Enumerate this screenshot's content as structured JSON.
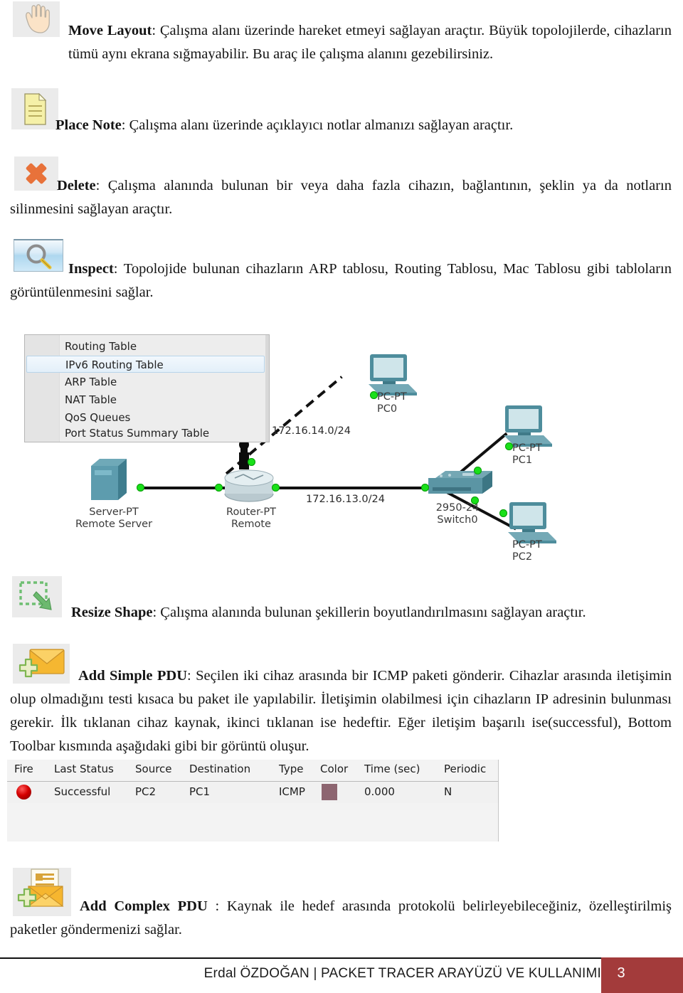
{
  "document": {
    "language": "Turkish",
    "sections": [
      {
        "id": "move-layout",
        "term": "Move Layout",
        "body": ": Çalışma alanı üzerinde hareket etmeyi sağlayan araçtır. Büyük topolojilerde, cihazların tümü aynı ekrana sığmayabilir. Bu araç ile çalışma alanını gezebilirsiniz.",
        "icon": "hand-icon"
      },
      {
        "id": "place-note",
        "term": "Place Note",
        "body": ": Çalışma alanı üzerinde açıklayıcı notlar almanızı sağlayan araçtır.",
        "icon": "note-icon"
      },
      {
        "id": "delete",
        "term": "Delete",
        "body": ": Çalışma alanında bulunan bir veya daha fazla cihazın, bağlantının, şeklin ya da notların silinmesini sağlayan araçtır.",
        "icon": "delete-x-icon"
      },
      {
        "id": "inspect",
        "term": "Inspect",
        "body": ": Topolojide bulunan cihazların ARP tablosu, Routing Tablosu, Mac Tablosu gibi tabloların görüntülenmesini sağlar.",
        "icon": "magnifier-icon"
      },
      {
        "id": "resize-shape",
        "term": "Resize Shape",
        "body": ": Çalışma alanında bulunan şekillerin boyutlandırılmasını sağlayan araçtır.",
        "icon": "resize-arrow-icon"
      },
      {
        "id": "add-simple-pdu",
        "term": "Add Simple PDU",
        "body": ": Seçilen iki cihaz arasında bir ICMP paketi gönderir. Cihazlar arasında iletişimin olup olmadığını testi kısaca bu paket ile yapılabilir. İletişimin olabilmesi için cihazların IP adresinin bulunması gerekir. İlk tıklanan cihaz kaynak, ikinci tıklanan ise hedeftir.  Eğer iletişim başarılı ise(successful), Bottom Toolbar kısmında aşağıdaki gibi bir görüntü oluşur.",
        "icon": "envelope-plus-icon"
      },
      {
        "id": "add-complex-pdu",
        "term": "Add Complex PDU",
        "body": " : Kaynak ile hedef arasında protokolü belirleyebileceğiniz, özelleştirilmiş paketler göndermenizi sağlar.",
        "icon": "envelope-letter-plus-icon"
      }
    ]
  },
  "topology_figure": {
    "context_menu": {
      "items": [
        "Routing Table",
        "IPv6 Routing Table",
        "ARP Table",
        "NAT Table",
        "QoS Queues",
        "Port Status Summary Table"
      ],
      "selected": "IPv6 Routing Table"
    },
    "devices": [
      {
        "id": "server",
        "model": "Server-PT",
        "name": "Remote Server"
      },
      {
        "id": "router",
        "model": "Router-PT",
        "name": "Remote"
      },
      {
        "id": "switch",
        "model": "2950-24",
        "name": "Switch0"
      },
      {
        "id": "pc0",
        "model": "PC-PT",
        "name": "PC0"
      },
      {
        "id": "pc1",
        "model": "PC-PT",
        "name": "PC1"
      },
      {
        "id": "pc2",
        "model": "PC-PT",
        "name": "PC2"
      }
    ],
    "network_labels": [
      "172.16.14.0/24",
      "172.16.13.0/24"
    ]
  },
  "pdu_table": {
    "columns": [
      "Fire",
      "Last Status",
      "Source",
      "Destination",
      "Type",
      "Color",
      "Time (sec)",
      "Periodic"
    ],
    "rows": [
      {
        "fire": "fire-button",
        "last_status": "Successful",
        "source": "PC2",
        "destination": "PC1",
        "type": "ICMP",
        "color": "#8d6570",
        "time_sec": "0.000",
        "periodic": "N"
      }
    ]
  },
  "footer": {
    "text": "Erdal ÖZDOĞAN | PACKET TRACER ARAYÜZÜ VE KULLANIMI",
    "page_number": "3",
    "accent_color": "#a33b3b"
  }
}
